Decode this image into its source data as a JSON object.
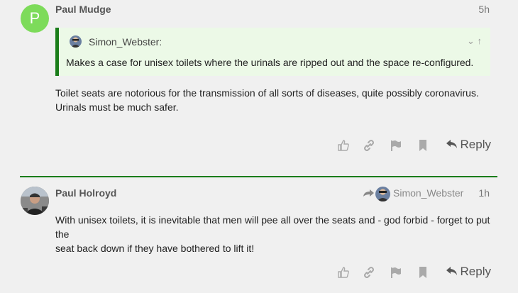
{
  "post1": {
    "avatar_letter": "P",
    "username": "Paul Mudge",
    "time": "5h",
    "quote": {
      "author": "Simon_Webster:",
      "text": "Makes a case for unisex toilets where the urinals are ripped out and the space re-configured.",
      "controls": "⌄ ↑"
    },
    "body_line1": "Toilet seats are notorious for the transmission of all sorts of diseases, quite possibly coronavirus.",
    "body_line2": "Urinals must be much safer.",
    "reply_label": "Reply"
  },
  "post2": {
    "username": "Paul Holroyd",
    "reply_to_user": "Simon_Webster",
    "time": "1h",
    "body_line1": "With unisex toilets, it is inevitable that men will pee all over the seats and - god forbid - forget to put the",
    "body_line2": "seat back down if they have bothered to lift it!",
    "reply_label": "Reply"
  },
  "colors": {
    "accent": "#1a7d1a",
    "quote_bg": "#ecf9e7",
    "avatar_letter_bg": "#7ddb5a"
  }
}
